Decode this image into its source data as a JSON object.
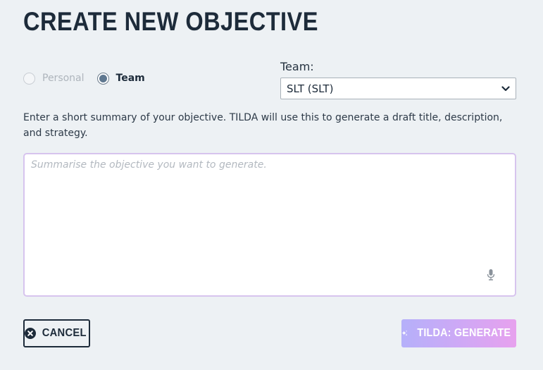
{
  "page": {
    "title": "CREATE NEW OBJECTIVE"
  },
  "owner_type": {
    "options": [
      {
        "label": "Personal",
        "selected": false,
        "disabled": true
      },
      {
        "label": "Team",
        "selected": true,
        "disabled": false
      }
    ]
  },
  "team": {
    "label": "Team:",
    "selected_value": "SLT (SLT)"
  },
  "helper_text": "Enter a short summary of your objective. TILDA will use this to generate a draft title, description, and strategy.",
  "summary": {
    "placeholder": "Summarise the objective you want to generate.",
    "value": "",
    "mic_icon": "microphone-icon"
  },
  "actions": {
    "cancel_label": "CANCEL",
    "cancel_icon": "close-circle-icon",
    "generate_label": "TILDA: GENERATE",
    "generate_icon": "sparkle-icon"
  },
  "colors": {
    "background": "#edf1f4",
    "text_dark": "#1d2b3a",
    "textarea_border": "#d7c4ee",
    "generate_gradient_start": "#b5b0fa",
    "generate_gradient_end": "#e7a1ee"
  }
}
